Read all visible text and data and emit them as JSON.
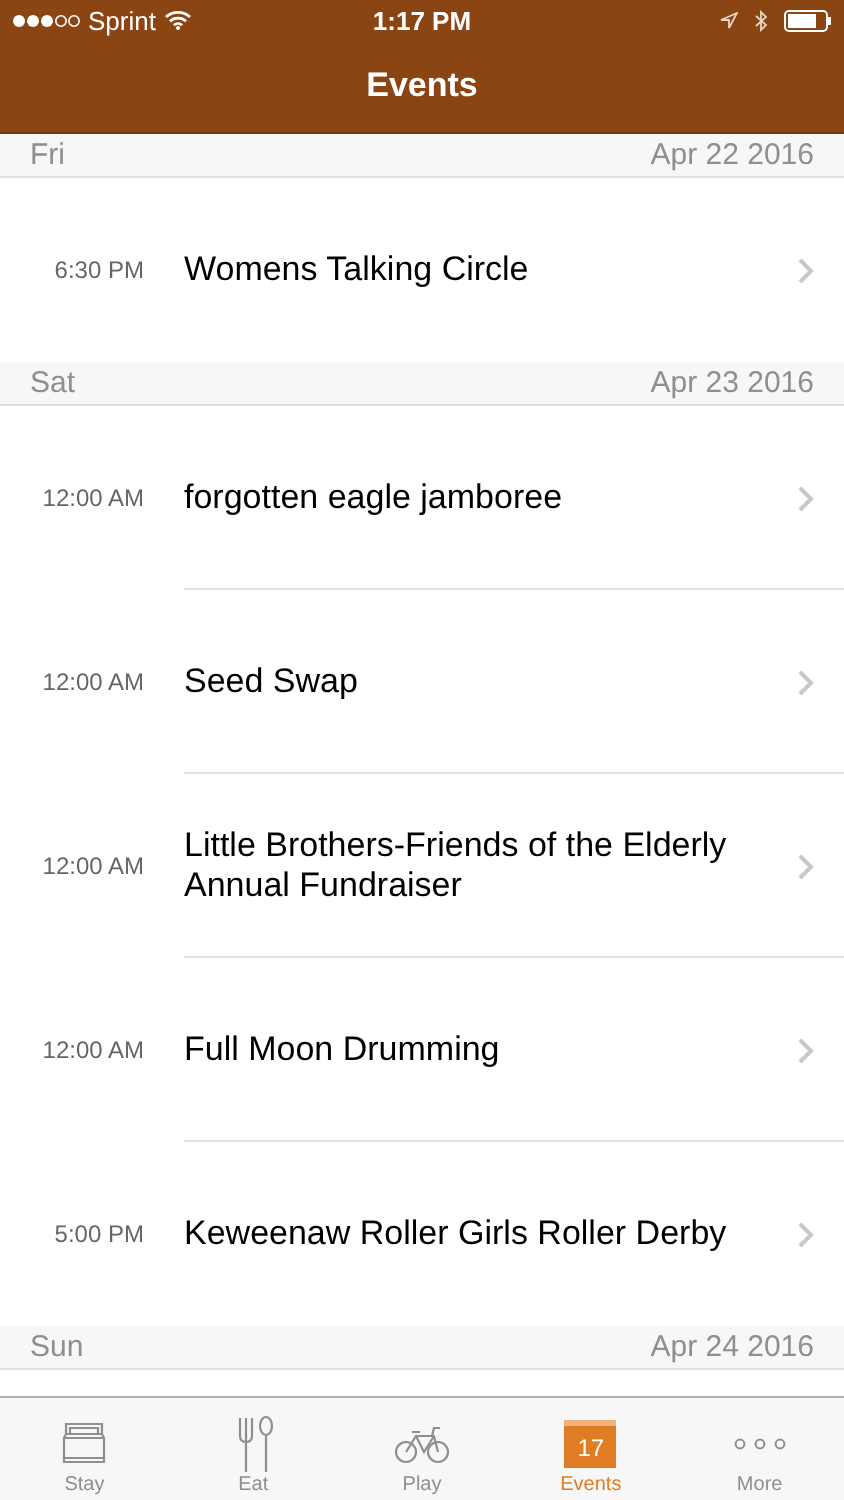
{
  "status_bar": {
    "carrier": "Sprint",
    "time": "1:17 PM"
  },
  "nav_bar": {
    "title": "Events"
  },
  "sections": [
    {
      "day": "Fri",
      "date": "Apr 22 2016",
      "events": [
        {
          "time": "6:30 PM",
          "title": "Womens Talking Circle"
        }
      ]
    },
    {
      "day": "Sat",
      "date": "Apr 23 2016",
      "events": [
        {
          "time": "12:00 AM",
          "title": "forgotten eagle jamboree"
        },
        {
          "time": "12:00 AM",
          "title": "Seed Swap"
        },
        {
          "time": "12:00 AM",
          "title": "Little Brothers-Friends of the Elderly Annual Fundraiser"
        },
        {
          "time": "12:00 AM",
          "title": "Full Moon Drumming"
        },
        {
          "time": "5:00 PM",
          "title": "Keweenaw Roller Girls Roller Derby"
        }
      ]
    },
    {
      "day": "Sun",
      "date": "Apr 24 2016"
    }
  ],
  "tab_bar": [
    {
      "kind": "bed",
      "label": "Stay",
      "selected": false
    },
    {
      "kind": "fork",
      "label": "Eat",
      "selected": false
    },
    {
      "kind": "bike",
      "label": "Play",
      "selected": false
    },
    {
      "kind": "calendar",
      "label": "Events",
      "icon_text": "17",
      "selected": true
    },
    {
      "kind": "more",
      "label": "More",
      "selected": false
    }
  ]
}
